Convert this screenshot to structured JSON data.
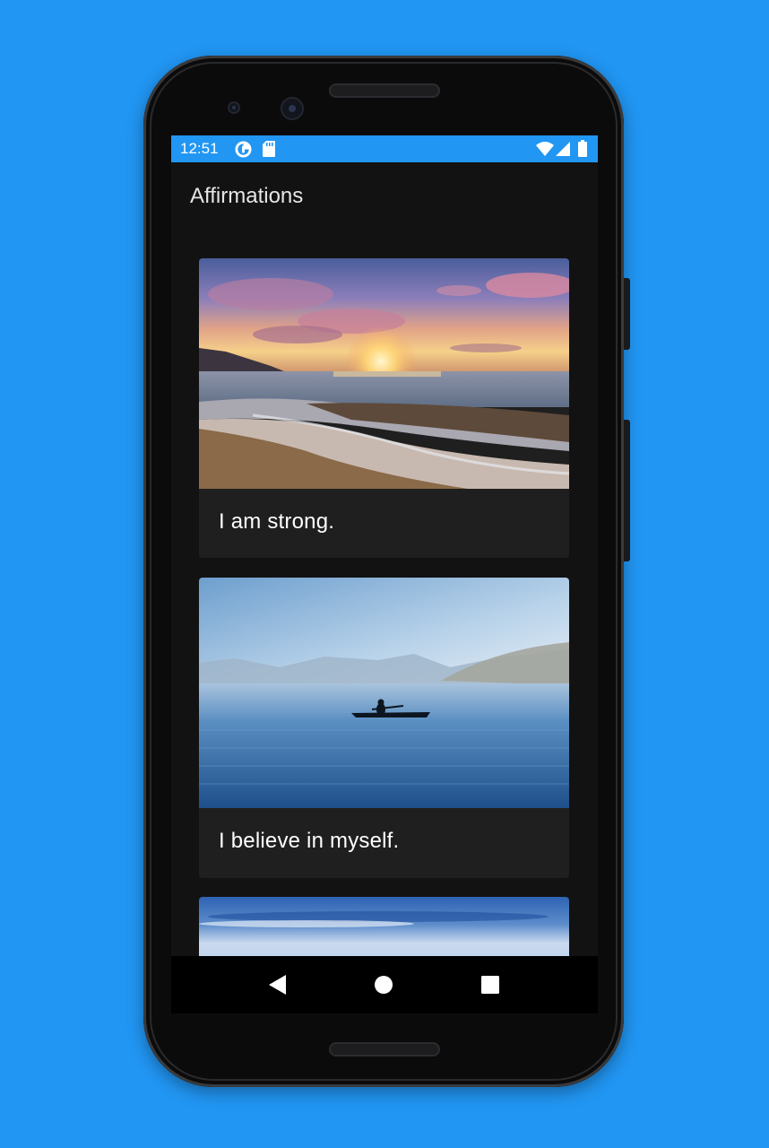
{
  "status_bar": {
    "time": "12:51",
    "left_icons": [
      "data-saver-icon",
      "sd-card-icon"
    ],
    "right_icons": [
      "wifi-icon",
      "cell-signal-icon",
      "battery-icon"
    ]
  },
  "app_bar": {
    "title": "Affirmations"
  },
  "affirmations": [
    {
      "text": "I am strong.",
      "image": "sunset-beach-image"
    },
    {
      "text": "I believe in myself.",
      "image": "kayak-lake-image"
    },
    {
      "text": "",
      "image": "blue-sky-image"
    }
  ],
  "nav_bar": {
    "buttons": [
      "back-icon",
      "home-icon",
      "recents-icon"
    ]
  },
  "colors": {
    "background": "#2196F3",
    "status_bar": "#2196F3",
    "screen": "#121212",
    "card": "#1f1f1f",
    "text": "#ffffff"
  }
}
